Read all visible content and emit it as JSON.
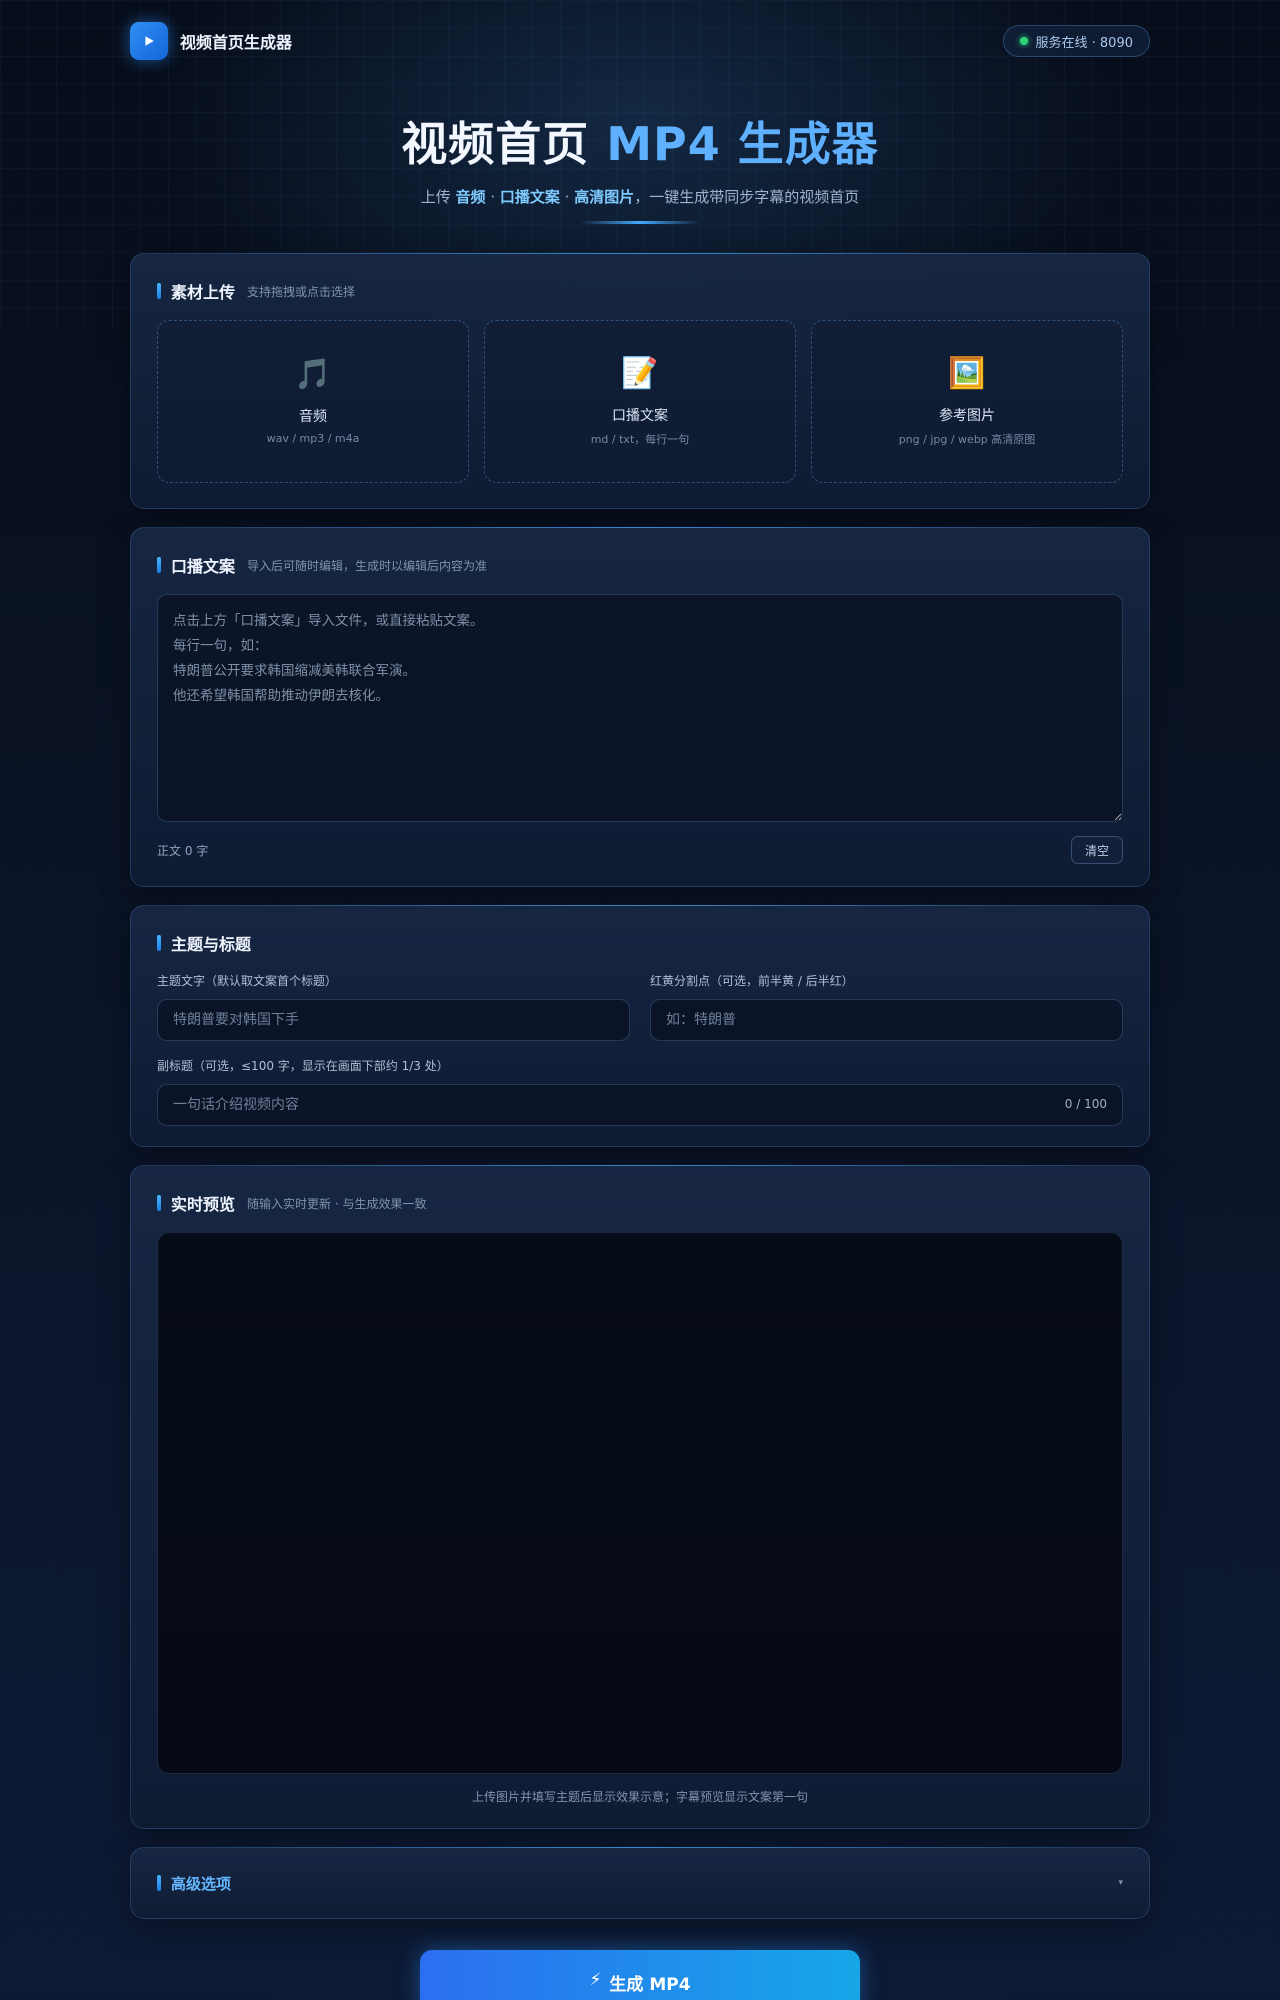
{
  "app": {
    "title": "视频首页生成器"
  },
  "status": {
    "text": "服务在线 · 8090",
    "color": "#2fd47a"
  },
  "hero": {
    "title_prefix": "视频首页",
    "title_accent": "MP4 生成器",
    "sub_prefix": "上传",
    "sub_item1": "音频",
    "sub_sep1": "·",
    "sub_item2": "口播文案",
    "sub_sep2": "·",
    "sub_item3": "高清图片",
    "sub_suffix": "，一键生成带同步字幕的视频首页"
  },
  "upload": {
    "title": "素材上传",
    "hint": "支持拖拽或点击选择",
    "boxes": [
      {
        "icon": "music-icon",
        "glyph": "🎵",
        "label": "音频",
        "formats": "wav / mp3 / m4a"
      },
      {
        "icon": "memo-icon",
        "glyph": "📝",
        "label": "口播文案",
        "formats": "md / txt，每行一句"
      },
      {
        "icon": "picture-icon",
        "glyph": "🖼️",
        "label": "参考图片",
        "formats": "png / jpg / webp 高清原图"
      }
    ]
  },
  "script": {
    "title": "口播文案",
    "hint": "导入后可随时编辑，生成时以编辑后内容为准",
    "value": "",
    "placeholder": "点击上方「口播文案」导入文件，或直接粘贴文案。\n每行一句，如：\n特朗普公开要求韩国缩减美韩联合军演。\n他还希望韩国帮助推动伊朗去核化。",
    "word_count": "正文 0 字",
    "clear_label": "清空"
  },
  "topic": {
    "title": "主题与标题",
    "main_label": "主题文字（默认取文案首个标题）",
    "main_placeholder": "特朗普要对韩国下手",
    "main_value": "",
    "split_label": "红黄分割点（可选，前半黄 / 后半红）",
    "split_placeholder": "如：特朗普",
    "split_value": "",
    "subtitle_label": "副标题（可选，≤100 字，显示在画面下部约 1/3 处）",
    "subtitle_placeholder": "一句话介绍视频内容",
    "subtitle_value": "",
    "subtitle_counter": "0 / 100"
  },
  "preview": {
    "title": "实时预览",
    "hint": "随输入实时更新 · 与生成效果一致",
    "note": "上传图片并填写主题后显示效果示意；字幕预览显示文案第一句"
  },
  "advanced": {
    "title": "高级选项",
    "chevron": "▾"
  },
  "generate": {
    "icon": "lightning-icon",
    "glyph": "⚡",
    "label": "生成 MP4"
  },
  "colors": {
    "accent": "#5fb0ff",
    "brand": "#2f8ff5",
    "button_from": "#2c6ef0",
    "button_to": "#16a7e8"
  }
}
